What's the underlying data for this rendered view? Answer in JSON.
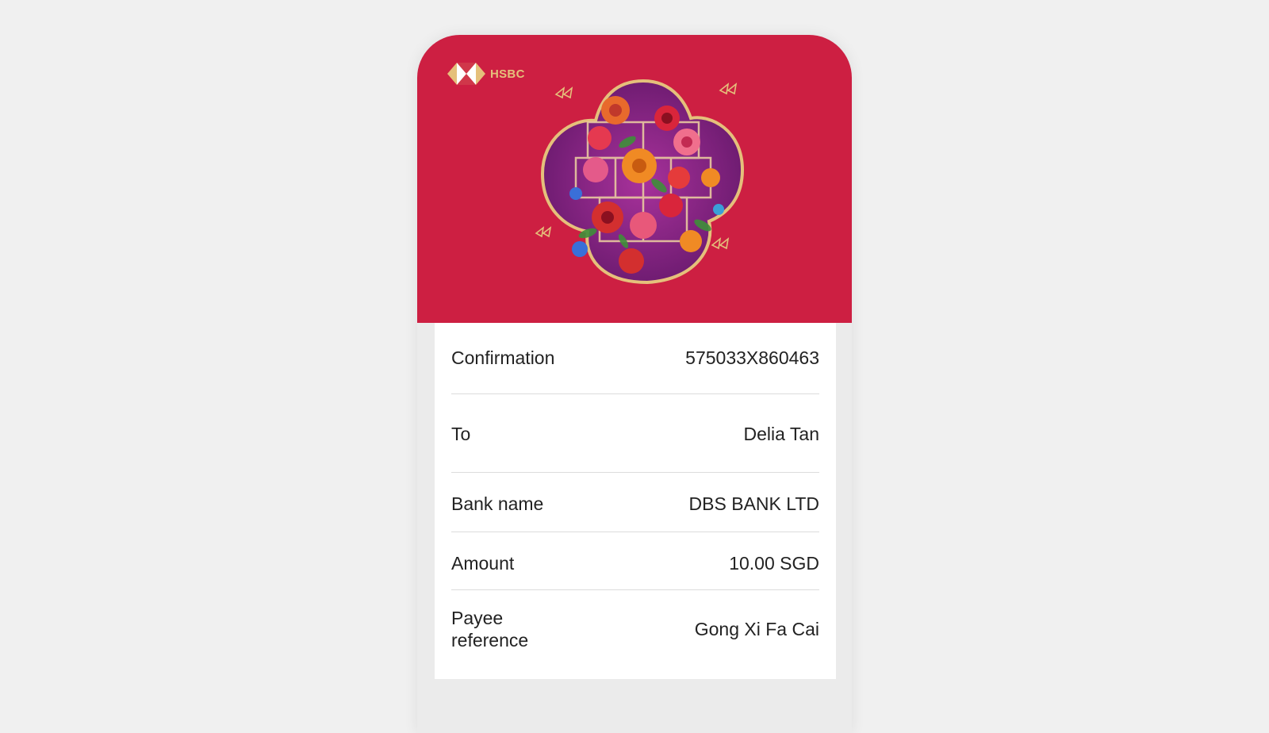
{
  "brand": {
    "name": "HSBC",
    "primary_color": "#cd1f42",
    "gold_color": "#e5c07b"
  },
  "header": {
    "logo_icon": "hsbc-hexagon-logo",
    "artwork": "floral-quatrefoil-lattice-illustration"
  },
  "details": [
    {
      "label": "Confirmation",
      "value": "575033X860463"
    },
    {
      "label": "To",
      "value": "Delia Tan"
    },
    {
      "label": "Bank name",
      "value": "DBS BANK LTD"
    },
    {
      "label": "Amount",
      "value": "10.00 SGD"
    },
    {
      "label": "Payee reference",
      "value": "Gong Xi Fa Cai"
    }
  ]
}
